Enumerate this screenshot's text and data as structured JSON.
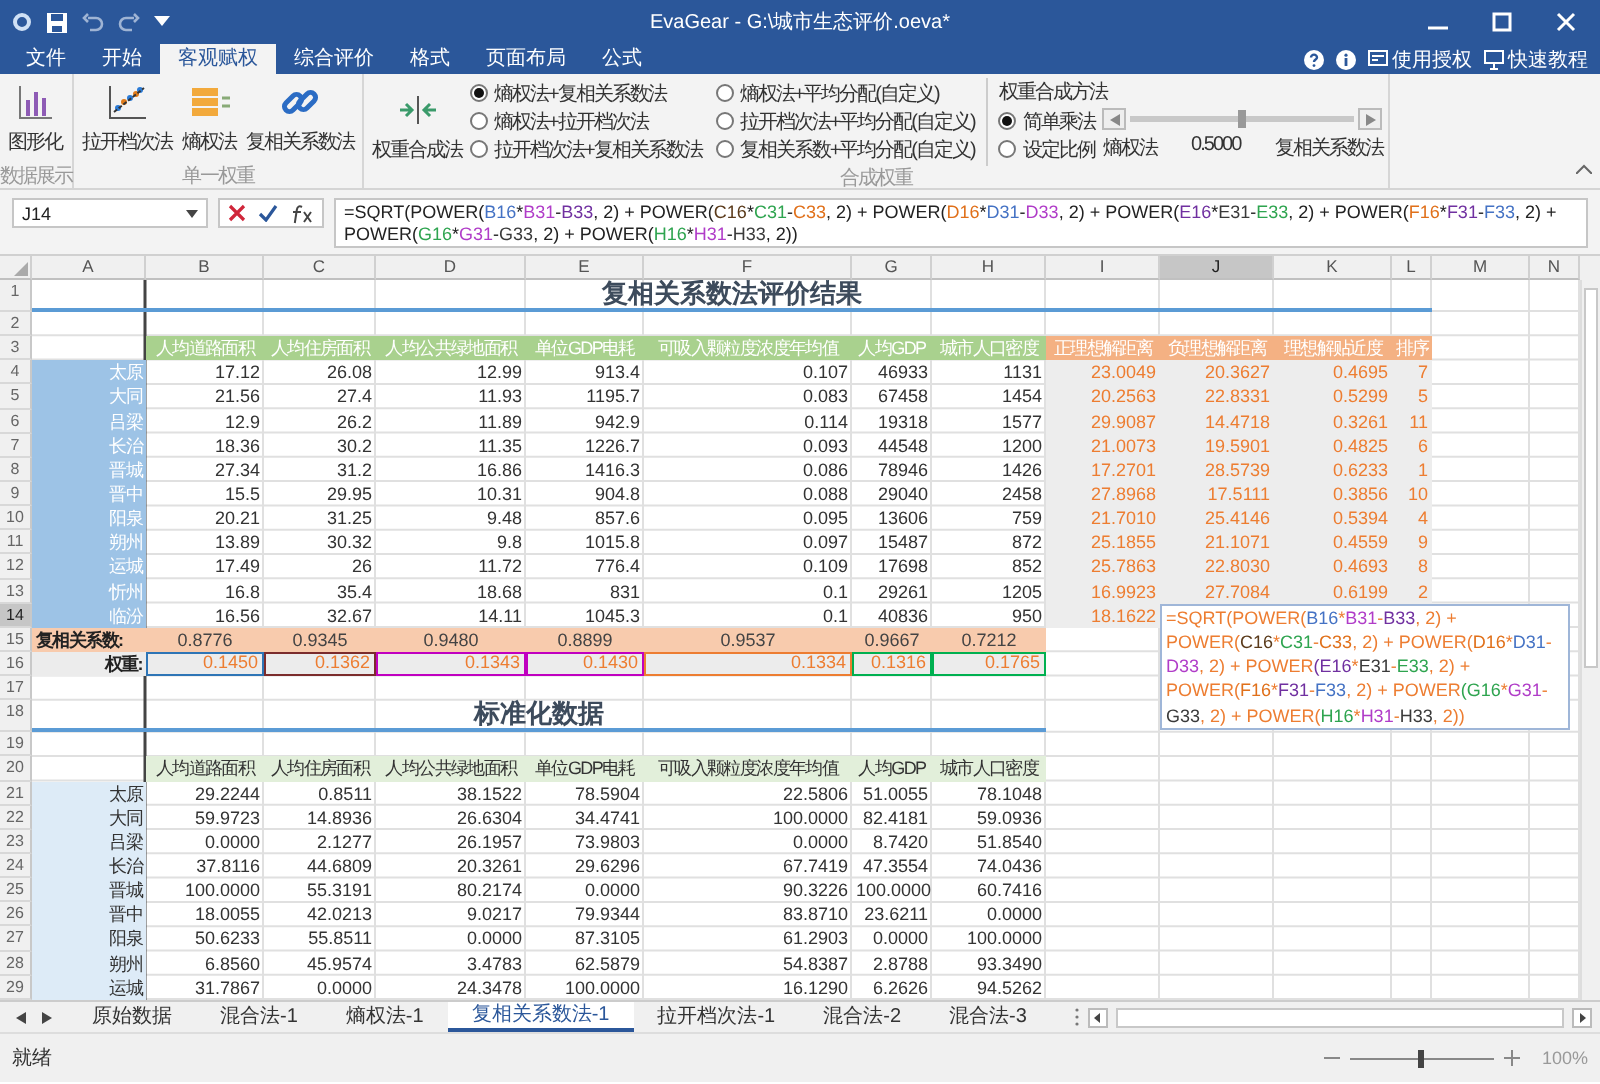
{
  "window": {
    "title": "EvaGear - G:\\城市生态评价.oeva*"
  },
  "menu_tabs": [
    {
      "label": "文件",
      "selected": false
    },
    {
      "label": "开始",
      "selected": false
    },
    {
      "label": "客观赋权",
      "selected": true
    },
    {
      "label": "综合评价",
      "selected": false
    },
    {
      "label": "格式",
      "selected": false
    },
    {
      "label": "页面布局",
      "selected": false
    },
    {
      "label": "公式",
      "selected": false
    }
  ],
  "help_links": [
    "使用授权",
    "快速教程"
  ],
  "ribbon": {
    "display_group": {
      "label": "数据展示",
      "button": "图形化"
    },
    "single_group": {
      "label": "单一权重",
      "buttons": [
        "拉开档次法",
        "熵权法",
        "复相关系数法"
      ]
    },
    "combined_group": {
      "label": "合成权重",
      "button": "权重合成法",
      "options": [
        {
          "label": "熵权法+复相关系数法",
          "selected": true
        },
        {
          "label": "熵权法+拉开档次法",
          "selected": false
        },
        {
          "label": "拉开档次法+复相关系数法",
          "selected": false
        },
        {
          "label": "熵权法+平均分配(自定义)",
          "selected": false
        },
        {
          "label": "拉开档次法+平均分配(自定义)",
          "selected": false
        },
        {
          "label": "复相关系数+平均分配(自定义)",
          "selected": false
        }
      ],
      "method": {
        "title": "权重合成方法",
        "options": [
          {
            "label": "简单乘法",
            "selected": true
          },
          {
            "label": "设定比例",
            "selected": false
          }
        ],
        "slider": {
          "level": 0.5,
          "left_label": "熵权法",
          "value": "0.5000",
          "right_label": "复相关系数法"
        }
      }
    }
  },
  "formula_bar": {
    "cell": "J14",
    "segments": [
      {
        "text": "=SQRT(POWER("
      },
      {
        "text": "B16",
        "color": "#4472c4"
      },
      {
        "text": "*"
      },
      {
        "text": "B31",
        "color": "#b03cc8"
      },
      {
        "text": "-"
      },
      {
        "text": "B33",
        "color": "#7030a0"
      },
      {
        "text": ", 2) + POWER("
      },
      {
        "text": "C16",
        "color": "#5a3a1a"
      },
      {
        "text": "*"
      },
      {
        "text": "C31",
        "color": "#2ea44f"
      },
      {
        "text": "-"
      },
      {
        "text": "C33",
        "color": "#e0701a"
      },
      {
        "text": ", 2) + POWER("
      },
      {
        "text": "D16",
        "color": "#e0701a"
      },
      {
        "text": "*"
      },
      {
        "text": "D31",
        "color": "#4472c4"
      },
      {
        "text": "-"
      },
      {
        "text": "D33",
        "color": "#b03cc8"
      },
      {
        "text": ", 2) + POWER("
      },
      {
        "text": "E16",
        "color": "#7030a0"
      },
      {
        "text": "*"
      },
      {
        "text": "E31",
        "color": "#3a3a3a"
      },
      {
        "text": "-"
      },
      {
        "text": "E33",
        "color": "#2ea44f"
      },
      {
        "text": ", 2) + POWER("
      },
      {
        "text": "F16",
        "color": "#e0701a"
      },
      {
        "text": "*"
      },
      {
        "text": "F31",
        "color": "#7030a0"
      },
      {
        "text": "-"
      },
      {
        "text": "F33",
        "color": "#4472c4"
      },
      {
        "text": ", 2) + POWER("
      },
      {
        "text": "G16",
        "color": "#2ea44f"
      },
      {
        "text": "*"
      },
      {
        "text": "G31",
        "color": "#b03cc8"
      },
      {
        "text": "-"
      },
      {
        "text": "G33",
        "color": "#3a3a3a"
      },
      {
        "text": ", 2) + POWER("
      },
      {
        "text": "H16",
        "color": "#2ea44f"
      },
      {
        "text": "*"
      },
      {
        "text": "H31",
        "color": "#b03cc8"
      },
      {
        "text": "-"
      },
      {
        "text": "H33",
        "color": "#3a3a3a"
      },
      {
        "text": ", 2))"
      }
    ]
  },
  "sheet": {
    "columns": [
      {
        "label": "A",
        "selected": false
      },
      {
        "label": "B",
        "selected": false
      },
      {
        "label": "C",
        "selected": false
      },
      {
        "label": "D",
        "selected": false
      },
      {
        "label": "E",
        "selected": false
      },
      {
        "label": "F",
        "selected": false
      },
      {
        "label": "G",
        "selected": false
      },
      {
        "label": "H",
        "selected": false
      },
      {
        "label": "I",
        "selected": false
      },
      {
        "label": "J",
        "selected": true
      },
      {
        "label": "K",
        "selected": false
      },
      {
        "label": "L",
        "selected": false
      },
      {
        "label": "M",
        "selected": false
      },
      {
        "label": "N",
        "selected": false
      }
    ],
    "row_numbers": [
      {
        "label": "1",
        "selected": false
      },
      {
        "label": "2",
        "selected": false
      },
      {
        "label": "3",
        "selected": false
      },
      {
        "label": "4",
        "selected": false
      },
      {
        "label": "5",
        "selected": false
      },
      {
        "label": "6",
        "selected": false
      },
      {
        "label": "7",
        "selected": false
      },
      {
        "label": "8",
        "selected": false
      },
      {
        "label": "9",
        "selected": false
      },
      {
        "label": "10",
        "selected": false
      },
      {
        "label": "11",
        "selected": false
      },
      {
        "label": "12",
        "selected": false
      },
      {
        "label": "13",
        "selected": false
      },
      {
        "label": "14",
        "selected": true
      },
      {
        "label": "15",
        "selected": false
      },
      {
        "label": "16",
        "selected": false
      },
      {
        "label": "17",
        "selected": false
      },
      {
        "label": "18",
        "selected": false
      },
      {
        "label": "19",
        "selected": false
      },
      {
        "label": "20",
        "selected": false
      },
      {
        "label": "21",
        "selected": false
      },
      {
        "label": "22",
        "selected": false
      },
      {
        "label": "23",
        "selected": false
      },
      {
        "label": "24",
        "selected": false
      },
      {
        "label": "25",
        "selected": false
      },
      {
        "label": "26",
        "selected": false
      },
      {
        "label": "27",
        "selected": false
      },
      {
        "label": "28",
        "selected": false
      },
      {
        "label": "29",
        "selected": false
      }
    ]
  },
  "results": {
    "title": "复相关系数法评价结果",
    "headers": [
      {
        "label": "人均道路面积",
        "kind": "indicator"
      },
      {
        "label": "人均住房面积",
        "kind": "indicator"
      },
      {
        "label": "人均公共绿地面积",
        "kind": "indicator"
      },
      {
        "label": "单位GDP电耗",
        "kind": "indicator"
      },
      {
        "label": "可吸入颗粒度浓度年均值",
        "kind": "indicator"
      },
      {
        "label": "人均GDP",
        "kind": "indicator"
      },
      {
        "label": "城市人口密度",
        "kind": "indicator"
      },
      {
        "label": "正理想解距离",
        "kind": "result"
      },
      {
        "label": "负理想解距离",
        "kind": "result"
      },
      {
        "label": "理想解贴近度",
        "kind": "result"
      },
      {
        "label": "排序",
        "kind": "result"
      }
    ],
    "rows": [
      {
        "city": "太原",
        "values": [
          "17.12",
          "26.08",
          "12.99",
          "913.4",
          "0.107",
          "46933",
          "1131"
        ],
        "results": [
          "23.0049",
          "20.3627",
          "0.4695",
          "7"
        ]
      },
      {
        "city": "大同",
        "values": [
          "21.56",
          "27.4",
          "11.93",
          "1195.7",
          "0.083",
          "67458",
          "1454"
        ],
        "results": [
          "20.2563",
          "22.8331",
          "0.5299",
          "5"
        ]
      },
      {
        "city": "吕梁",
        "values": [
          "12.9",
          "26.2",
          "11.89",
          "942.9",
          "0.114",
          "19318",
          "1577"
        ],
        "results": [
          "29.9087",
          "14.4718",
          "0.3261",
          "11"
        ]
      },
      {
        "city": "长治",
        "values": [
          "18.36",
          "30.2",
          "11.35",
          "1226.7",
          "0.093",
          "44548",
          "1200"
        ],
        "results": [
          "21.0073",
          "19.5901",
          "0.4825",
          "6"
        ]
      },
      {
        "city": "晋城",
        "values": [
          "27.34",
          "31.2",
          "16.86",
          "1416.3",
          "0.086",
          "78946",
          "1426"
        ],
        "results": [
          "17.2701",
          "28.5739",
          "0.6233",
          "1"
        ]
      },
      {
        "city": "晋中",
        "values": [
          "15.5",
          "29.95",
          "10.31",
          "904.8",
          "0.088",
          "29040",
          "2458"
        ],
        "results": [
          "27.8968",
          "17.5111",
          "0.3856",
          "10"
        ]
      },
      {
        "city": "阳泉",
        "values": [
          "20.21",
          "31.25",
          "9.48",
          "857.6",
          "0.095",
          "13606",
          "759"
        ],
        "results": [
          "21.7010",
          "25.4146",
          "0.5394",
          "4"
        ]
      },
      {
        "city": "朔州",
        "values": [
          "13.89",
          "30.32",
          "9.8",
          "1015.8",
          "0.097",
          "15487",
          "872"
        ],
        "results": [
          "25.1855",
          "21.1071",
          "0.4559",
          "9"
        ]
      },
      {
        "city": "运城",
        "values": [
          "17.49",
          "26",
          "11.72",
          "776.4",
          "0.109",
          "17698",
          "852"
        ],
        "results": [
          "25.7863",
          "22.8030",
          "0.4693",
          "8"
        ]
      },
      {
        "city": "忻州",
        "values": [
          "16.8",
          "35.4",
          "18.68",
          "831",
          "0.1",
          "29261",
          "1205"
        ],
        "results": [
          "16.9923",
          "27.7084",
          "0.6199",
          "2"
        ]
      },
      {
        "city": "临汾",
        "values": [
          "16.56",
          "32.67",
          "14.11",
          "1045.3",
          "0.1",
          "40836",
          "950"
        ],
        "results": [
          "18.1622"
        ]
      }
    ],
    "correlation": {
      "label": "复相关系数:",
      "values": [
        "0.8776",
        "0.9345",
        "0.9480",
        "0.8899",
        "0.9537",
        "0.9667",
        "0.7212"
      ]
    },
    "weights": {
      "label": "权重:",
      "values": [
        {
          "value": "0.1450",
          "color": "#2e75b6"
        },
        {
          "value": "0.1362",
          "color": "#7b2c2c"
        },
        {
          "value": "0.1343",
          "color": "#c000c0"
        },
        {
          "value": "0.1430",
          "color": "#c000c0"
        },
        {
          "value": "0.1334",
          "color": "#ed7d31"
        },
        {
          "value": "0.1316",
          "color": "#00b050"
        },
        {
          "value": "0.1765",
          "color": "#00b050"
        }
      ]
    }
  },
  "cell_editor": {
    "segments": [
      {
        "text": "=SQRT(POWER("
      },
      {
        "text": "B16",
        "color": "#4472c4"
      },
      {
        "text": "*"
      },
      {
        "text": "B31",
        "color": "#b03cc8"
      },
      {
        "text": "-"
      },
      {
        "text": "B33",
        "color": "#7030a0"
      },
      {
        "text": ", 2) + POWER("
      },
      {
        "text": "C16",
        "color": "#5a3a1a"
      },
      {
        "text": "*"
      },
      {
        "text": "C31",
        "color": "#2ea44f"
      },
      {
        "text": "-"
      },
      {
        "text": "C33",
        "color": "#e0701a"
      },
      {
        "text": ", 2) + POWER("
      },
      {
        "text": "D16",
        "color": "#e0701a"
      },
      {
        "text": "*"
      },
      {
        "text": "D31",
        "color": "#4472c4"
      },
      {
        "text": "-"
      },
      {
        "text": "D33",
        "color": "#b03cc8"
      },
      {
        "text": ", 2) + POWER"
      },
      {
        "text": "(E16",
        "color": "#7030a0"
      },
      {
        "text": "*"
      },
      {
        "text": "E31",
        "color": "#3a3a3a"
      },
      {
        "text": "-"
      },
      {
        "text": "E33",
        "color": "#2ea44f"
      },
      {
        "text": ", 2) + POWER("
      },
      {
        "text": "F16",
        "color": "#e0701a"
      },
      {
        "text": "*"
      },
      {
        "text": "F31",
        "color": "#7030a0"
      },
      {
        "text": "-"
      },
      {
        "text": "F33",
        "color": "#4472c4"
      },
      {
        "text": ", 2) + POWER"
      },
      {
        "text": "(G16",
        "color": "#2ea44f"
      },
      {
        "text": "*"
      },
      {
        "text": "G31",
        "color": "#b03cc8"
      },
      {
        "text": "-"
      },
      {
        "text": "G33",
        "color": "#3a3a3a"
      },
      {
        "text": ", 2) + POWER("
      },
      {
        "text": "H16",
        "color": "#2ea44f"
      },
      {
        "text": "*"
      },
      {
        "text": "H31",
        "color": "#b03cc8"
      },
      {
        "text": "-"
      },
      {
        "text": "H33",
        "color": "#3a3a3a"
      },
      {
        "text": ", 2))"
      }
    ]
  },
  "standardized": {
    "title": "标准化数据",
    "headers": [
      "人均道路面积",
      "人均住房面积",
      "人均公共绿地面积",
      "单位GDP电耗",
      "可吸入颗粒度浓度年均值",
      "人均GDP",
      "城市人口密度"
    ],
    "rows": [
      {
        "city": "太原",
        "values": [
          "29.2244",
          "0.8511",
          "38.1522",
          "78.5904",
          "22.5806",
          "51.0055",
          "78.1048"
        ]
      },
      {
        "city": "大同",
        "values": [
          "59.9723",
          "14.8936",
          "26.6304",
          "34.4741",
          "100.0000",
          "82.4181",
          "59.0936"
        ]
      },
      {
        "city": "吕梁",
        "values": [
          "0.0000",
          "2.1277",
          "26.1957",
          "73.9803",
          "0.0000",
          "8.7420",
          "51.8540"
        ]
      },
      {
        "city": "长治",
        "values": [
          "37.8116",
          "44.6809",
          "20.3261",
          "29.6296",
          "67.7419",
          "47.3554",
          "74.0436"
        ]
      },
      {
        "city": "晋城",
        "values": [
          "100.0000",
          "55.3191",
          "80.2174",
          "0.0000",
          "90.3226",
          "100.0000",
          "60.7416"
        ]
      },
      {
        "city": "晋中",
        "values": [
          "18.0055",
          "42.0213",
          "9.0217",
          "79.9344",
          "83.8710",
          "23.6211",
          "0.0000"
        ]
      },
      {
        "city": "阳泉",
        "values": [
          "50.6233",
          "55.8511",
          "0.0000",
          "87.3105",
          "61.2903",
          "0.0000",
          "100.0000"
        ]
      },
      {
        "city": "朔州",
        "values": [
          "6.8560",
          "45.9574",
          "3.4783",
          "62.5879",
          "54.8387",
          "2.8788",
          "93.3490"
        ]
      },
      {
        "city": "运城",
        "values": [
          "31.7867",
          "0.0000",
          "24.3478",
          "100.0000",
          "16.1290",
          "6.2626",
          "94.5262"
        ]
      }
    ]
  },
  "sheet_tabs": [
    {
      "label": "原始数据",
      "selected": false
    },
    {
      "label": "混合法-1",
      "selected": false
    },
    {
      "label": "熵权法-1",
      "selected": false
    },
    {
      "label": "复相关系数法-1",
      "selected": true
    },
    {
      "label": "拉开档次法-1",
      "selected": false
    },
    {
      "label": "混合法-2",
      "selected": false
    },
    {
      "label": "混合法-3",
      "selected": false
    }
  ],
  "status_bar": {
    "text": "就绪",
    "zoom": {
      "level": 0.5,
      "label": "100%"
    }
  }
}
